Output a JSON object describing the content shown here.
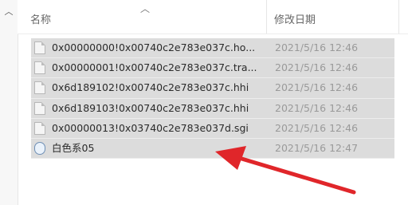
{
  "header": {
    "name_label": "名称",
    "date_label": "修改日期"
  },
  "left_pane": {
    "icon": "chevron-up-icon"
  },
  "files": [
    {
      "name": "0x00000000!0x00740c2e783e037c.ho...",
      "date": "2021/5/16 12:46",
      "icon": "file-icon"
    },
    {
      "name": "0x00000001!0x00740c2e783e037c.tra...",
      "date": "2021/5/16 12:46",
      "icon": "file-icon"
    },
    {
      "name": "0x6d189102!0x00740c2e783e037c.hhi",
      "date": "2021/5/16 12:46",
      "icon": "file-icon"
    },
    {
      "name": "0x6d189103!0x00740c2e783e037c.hhi",
      "date": "2021/5/16 12:46",
      "icon": "file-icon"
    },
    {
      "name": "0x00000013!0x03740c2e783e037d.sgi",
      "date": "2021/5/16 12:46",
      "icon": "file-icon"
    },
    {
      "name": "白色系05",
      "date": "2021/5/16 12:47",
      "icon": "theme-file-icon"
    }
  ],
  "annotation": {
    "color": "#e0262a",
    "icon": "red-arrow"
  }
}
